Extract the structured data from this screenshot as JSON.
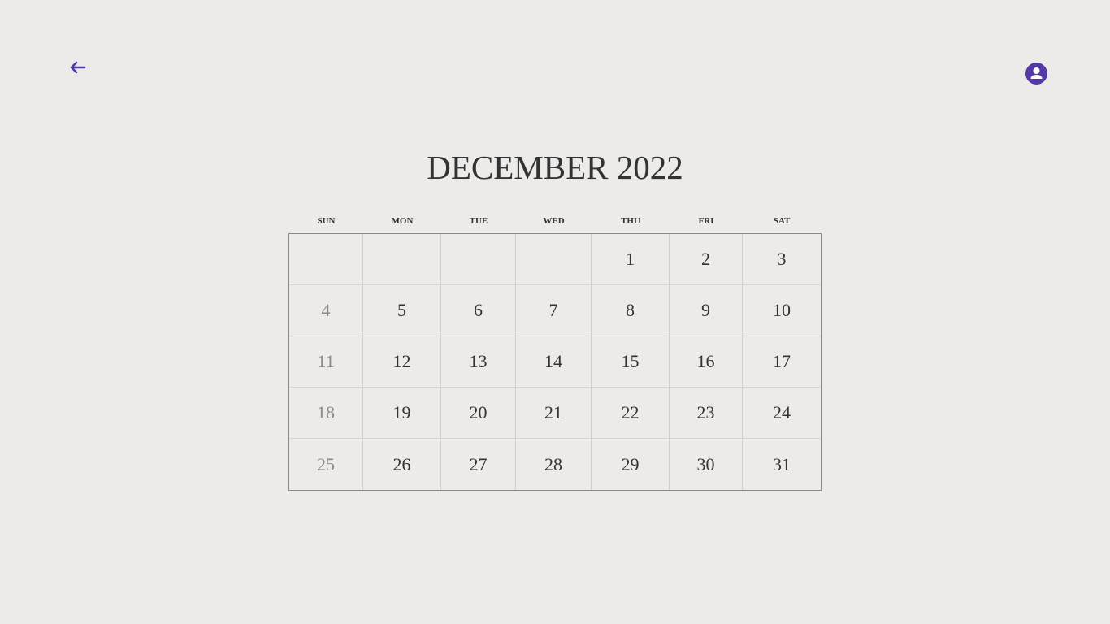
{
  "header": {
    "back_icon": "arrow-left-icon",
    "avatar_icon": "user-circle-icon",
    "accent": "#5438a6"
  },
  "calendar": {
    "title": "DECEMBER 2022",
    "weekdays": [
      "SUN",
      "MON",
      "TUE",
      "WED",
      "THU",
      "FRI",
      "SAT"
    ],
    "weeks": [
      [
        "",
        "",
        "",
        "",
        "1",
        "2",
        "3"
      ],
      [
        "4",
        "5",
        "6",
        "7",
        "8",
        "9",
        "10"
      ],
      [
        "11",
        "12",
        "13",
        "14",
        "15",
        "16",
        "17"
      ],
      [
        "18",
        "19",
        "20",
        "21",
        "22",
        "23",
        "24"
      ],
      [
        "25",
        "26",
        "27",
        "28",
        "29",
        "30",
        "31"
      ]
    ]
  }
}
